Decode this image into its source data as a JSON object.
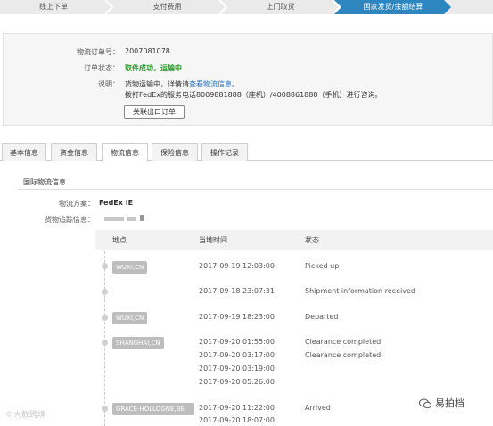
{
  "steps": [
    "线上下单",
    "支付费用",
    "上门取货",
    "国家发货/余额结算"
  ],
  "order": {
    "number_label": "物流订单号：",
    "number": "2007081078",
    "status_label": "订单状态：",
    "status": "取件成功，运输中",
    "note_label": "说明：",
    "note_line1_prefix": "货物运输中，详情请",
    "note_link": "查看物流信息",
    "note_line1_suffix": "。",
    "note_line2": "拨打FedEx的服务电话8009881888（座机）/4008861888（手机）进行咨询。",
    "button": "关联出口订单"
  },
  "tabs": [
    "基本信息",
    "资金信息",
    "物流信息",
    "保险信息",
    "操作记录"
  ],
  "logistics": {
    "section_title": "国际物流信息",
    "plan_label": "物流方案：",
    "plan": "FedEx IE",
    "tracking_label": "货物追踪信息："
  },
  "table": {
    "headers": [
      "地点",
      "当地时间",
      "状态"
    ],
    "rows": [
      {
        "loc": "WUXI,CN",
        "time": "2017-09-19 12:03:00",
        "status": "Picked up"
      },
      {
        "loc": "",
        "time": "2017-09-18 23:07:31",
        "status": "Shipment information received"
      },
      {
        "loc": "WUXI,CN",
        "time": "2017-09-19 18:23:00",
        "status": "Departed"
      },
      {
        "loc": "SHANGHAI,CN",
        "time": "2017-09-20 01:55:00",
        "status": "Clearance completed"
      },
      {
        "loc": "",
        "time": "2017-09-20 03:17:00",
        "status": "Clearance completed"
      },
      {
        "loc": "",
        "time": "2017-09-20 03:19:00",
        "status": ""
      },
      {
        "loc": "",
        "time": "2017-09-20 05:26:00",
        "status": ""
      },
      {
        "loc": "GRACE-HOLLOGNE,BE",
        "time": "2017-09-20 11:22:00",
        "status": "Arrived"
      },
      {
        "loc": "",
        "time": "2017-09-20 18:07:00",
        "status": ""
      }
    ]
  },
  "watermark": "©大数跨境",
  "wechat_name": "易拍档",
  "colors": {
    "active_step": "#2e86c1",
    "status_green": "#1e9c22",
    "link": "#1f6fc0"
  }
}
